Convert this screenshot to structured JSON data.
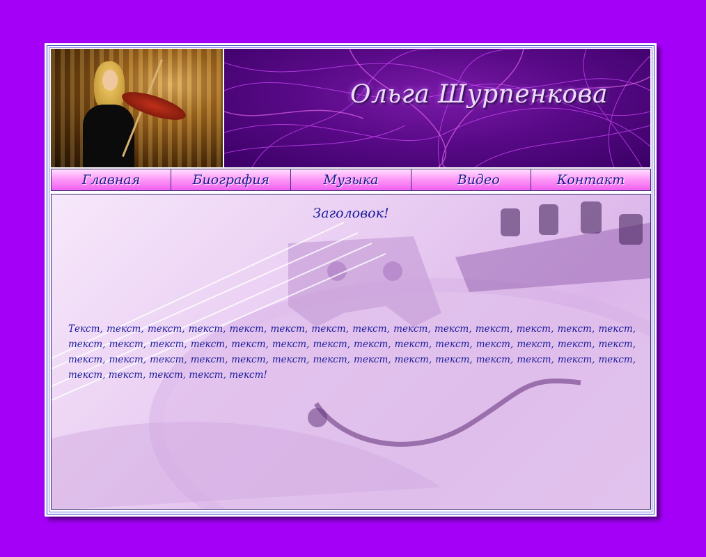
{
  "header": {
    "site_title": "Ольга Шурпенкова",
    "photo": "violinist-photo"
  },
  "nav": {
    "items": [
      {
        "label": "Главная"
      },
      {
        "label": "Биография"
      },
      {
        "label": "Музыка"
      },
      {
        "label": "Видео"
      },
      {
        "label": "Контакт"
      }
    ]
  },
  "main": {
    "heading": "Заголовок!",
    "body": "Текст, текст, текст, текст, текст, текст, текст, текст, текст, текст, текст, текст, текст, текст, текст, текст, текст, текст, текст, текст, текст, текст, текст, текст, текст, текст, текст, текст, текст, текст, текст, текст, текст, текст, текст, текст, текст, текст, текст, текст, текст, текст, текст, текст, текст, текст, текст!"
  },
  "colors": {
    "page_background": "#a400f8",
    "nav_gradient_top": "#ffe0ff",
    "nav_gradient_bottom": "#f060f0",
    "text": "#1a1a9a"
  }
}
